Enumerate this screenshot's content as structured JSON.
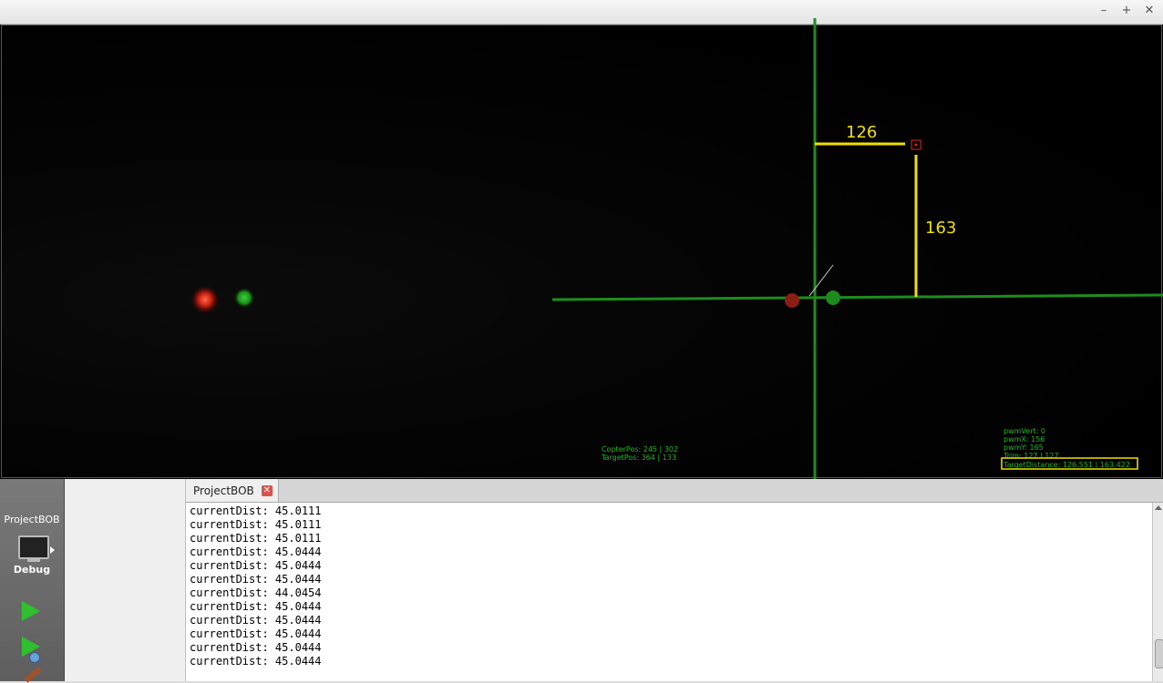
{
  "window": {
    "controls": {
      "minimize": "–",
      "maximize": "+",
      "close": "✕"
    }
  },
  "overlay": {
    "horizontal_distance": "126",
    "vertical_distance": "163",
    "copter_pos": "CopterPos: 245 | 302",
    "target_pos": "TargetPos: 364 | 133",
    "pwm_vert": "pwmVert: 0",
    "pwm_x": "pwmX: 156",
    "pwm_y": "pwmY: 165",
    "trim": "Trim: 127 | 127",
    "target_distance": "TargetDistance: 126.551 | 163.422",
    "colors": {
      "crosshair": "#1e8c1e",
      "measure": "#f0e000",
      "hud": "#17b817",
      "target": "#e02020"
    }
  },
  "modebar": {
    "project": "ProjectBOB",
    "build_config": "Debug",
    "icons": [
      "monitor-icon",
      "run-icon",
      "run-debug-icon",
      "build-icon"
    ]
  },
  "output_pane": {
    "tab_label": "ProjectBOB",
    "close_glyph": "✕",
    "lines": [
      "currentDist: 45.0111",
      "currentDist: 45.0111",
      "currentDist: 45.0111",
      "currentDist: 45.0444",
      "currentDist: 45.0444",
      "currentDist: 45.0444",
      "currentDist: 44.0454",
      "currentDist: 45.0444",
      "currentDist: 45.0444",
      "currentDist: 45.0444",
      "currentDist: 45.0444",
      "currentDist: 45.0444"
    ]
  }
}
